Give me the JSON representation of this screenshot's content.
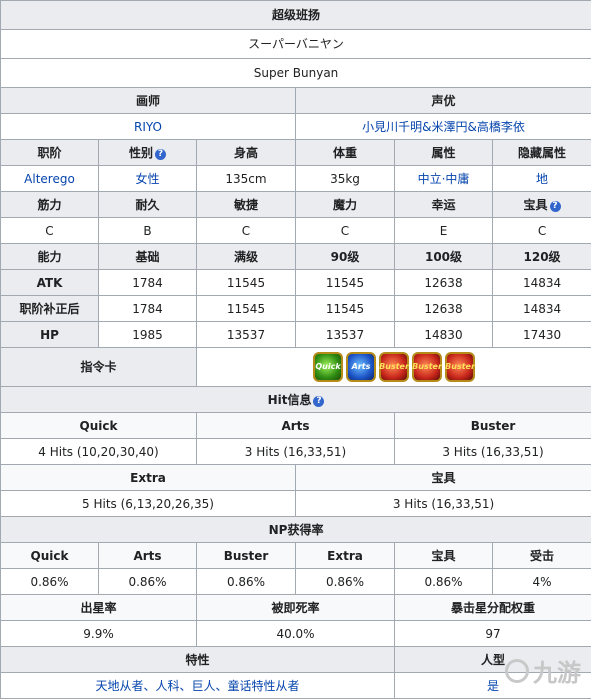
{
  "title": "超级班扬",
  "jp_name": "スーパーバニヤン",
  "en_name": "Super Bunyan",
  "labels": {
    "illustrator": "画师",
    "voice": "声优",
    "class": "职阶",
    "gender": "性别",
    "height": "身高",
    "weight": "体重",
    "attribute": "属性",
    "hidden_attribute": "隐藏属性",
    "strength": "筋力",
    "endurance": "耐久",
    "agility": "敏捷",
    "magic": "魔力",
    "luck": "幸运",
    "np": "宝具",
    "ability": "能力",
    "base": "基础",
    "max": "满级",
    "lv90": "90级",
    "lv100": "100级",
    "lv120": "120级",
    "atk": "ATK",
    "class_atk": "职阶补正后",
    "hp": "HP",
    "command_cards": "指令卡",
    "hit_info": "Hit信息",
    "quick": "Quick",
    "arts": "Arts",
    "buster": "Buster",
    "extra": "Extra",
    "np_gain": "NP获得率",
    "defense": "受击",
    "star_rate": "出星率",
    "death_rate": "被即死率",
    "star_weight": "暴击星分配权重",
    "traits": "特性",
    "humanoid": "人型",
    "help": "?"
  },
  "illustrator": "RIYO",
  "voice": "小見川千明&米澤円&高橋李依",
  "class": "Alterego",
  "gender": "女性",
  "height": "135cm",
  "weight": "35kg",
  "attribute": "中立·中庸",
  "hidden_attribute": "地",
  "stats": {
    "strength": "C",
    "endurance": "B",
    "agility": "C",
    "magic": "C",
    "luck": "E",
    "np": "C"
  },
  "atk": [
    "1784",
    "11545",
    "11545",
    "12638",
    "14834"
  ],
  "class_atk": [
    "1784",
    "11545",
    "11545",
    "12638",
    "14834"
  ],
  "hp": [
    "1985",
    "13537",
    "13537",
    "14830",
    "17430"
  ],
  "cards": [
    {
      "type": "quick",
      "text": "Quick"
    },
    {
      "type": "arts",
      "text": "Arts"
    },
    {
      "type": "buster",
      "text": "Buster"
    },
    {
      "type": "buster",
      "text": "Buster"
    },
    {
      "type": "buster",
      "text": "Buster"
    }
  ],
  "hits": {
    "quick": "4 Hits (10,20,30,40)",
    "arts": "3 Hits (16,33,51)",
    "buster": "3 Hits (16,33,51)",
    "extra": "5 Hits (6,13,20,26,35)",
    "np": "3 Hits (16,33,51)"
  },
  "np_gain": {
    "quick": "0.86%",
    "arts": "0.86%",
    "buster": "0.86%",
    "extra": "0.86%",
    "np": "0.86%",
    "defense": "4%"
  },
  "star_rate": "9.9%",
  "death_rate": "40.0%",
  "star_weight": "97",
  "traits": "天地从者、人科、巨人、童话特性从者",
  "humanoid": "是",
  "watermark": "九游"
}
